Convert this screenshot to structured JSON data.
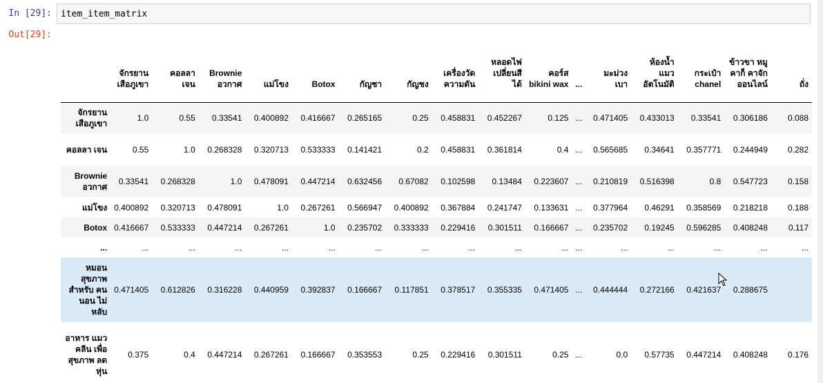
{
  "input_prompt": "In [29]:",
  "output_prompt": "Out[29]:",
  "code": "item_item_matrix",
  "columns": [
    "จักรยาน เสือภูเขา",
    "คอลลา เจน",
    "Brownie อวกาศ",
    "แม่โขง",
    "Botox",
    "กัญชา",
    "กัญชง",
    "เครื่องวัด ความดัน",
    "หลอดไฟ เปลี่ยนสี ได้",
    "คอร์ส bikini wax",
    "...",
    "มะม่วง เบา",
    "ห้องน้ำ แมว อัตโนมัติ",
    "กระเป๋า chanel",
    "ข้าวขา หมูคาก็ คาจัก ออนไลน์",
    "ถั่ง"
  ],
  "rows": [
    {
      "label": "จักรยาน เสือภูเขา",
      "values": [
        "1.0",
        "0.55",
        "0.33541",
        "0.400892",
        "0.416667",
        "0.265165",
        "0.25",
        "0.458831",
        "0.452267",
        "0.125",
        "...",
        "0.471405",
        "0.433013",
        "0.33541",
        "0.306186",
        "0.088"
      ]
    },
    {
      "label": "คอลลา เจน",
      "values": [
        "0.55",
        "1.0",
        "0.268328",
        "0.320713",
        "0.533333",
        "0.141421",
        "0.2",
        "0.458831",
        "0.361814",
        "0.4",
        "...",
        "0.565685",
        "0.34641",
        "0.357771",
        "0.244949",
        "0.282"
      ]
    },
    {
      "label": "Brownie อวกาศ",
      "values": [
        "0.33541",
        "0.268328",
        "1.0",
        "0.478091",
        "0.447214",
        "0.632456",
        "0.67082",
        "0.102598",
        "0.13484",
        "0.223607",
        "...",
        "0.210819",
        "0.516398",
        "0.8",
        "0.547723",
        "0.158"
      ]
    },
    {
      "label": "แม่โขง",
      "values": [
        "0.400892",
        "0.320713",
        "0.478091",
        "1.0",
        "0.267261",
        "0.566947",
        "0.400892",
        "0.367884",
        "0.241747",
        "0.133631",
        "...",
        "0.377964",
        "0.46291",
        "0.358569",
        "0.218218",
        "0.188"
      ]
    },
    {
      "label": "Botox",
      "values": [
        "0.416667",
        "0.533333",
        "0.447214",
        "0.267261",
        "1.0",
        "0.235702",
        "0.333333",
        "0.229416",
        "0.301511",
        "0.166667",
        "...",
        "0.235702",
        "0.19245",
        "0.596285",
        "0.408248",
        "0.117"
      ]
    },
    {
      "label": "...",
      "values": [
        "...",
        "...",
        "...",
        "...",
        "...",
        "...",
        "...",
        "...",
        "...",
        "...",
        "...",
        "...",
        "...",
        "...",
        "...",
        "..."
      ]
    },
    {
      "label": "หมอน สุขภาพ สำหรับ คนนอน ไม่หลับ",
      "values": [
        "0.471405",
        "0.612826",
        "0.316228",
        "0.440959",
        "0.392837",
        "0.166667",
        "0.117851",
        "0.378517",
        "0.355335",
        "0.471405",
        "...",
        "0.444444",
        "0.272166",
        "0.421637",
        "0.288675",
        ""
      ]
    },
    {
      "label": "อาหาร แมวคลีน เพื่อ สุขภาพ ลดหุ่น",
      "values": [
        "0.375",
        "0.4",
        "0.447214",
        "0.267261",
        "0.166667",
        "0.353553",
        "0.25",
        "0.229416",
        "0.301511",
        "0.25",
        "...",
        "0.0",
        "0.57735",
        "0.447214",
        "0.408248",
        "0.176"
      ]
    }
  ],
  "colors": {
    "row_even": "#f5f5f5",
    "row_hover": "#dbeaf7",
    "prompt_in": "#303f9f",
    "prompt_out": "#d84315"
  }
}
